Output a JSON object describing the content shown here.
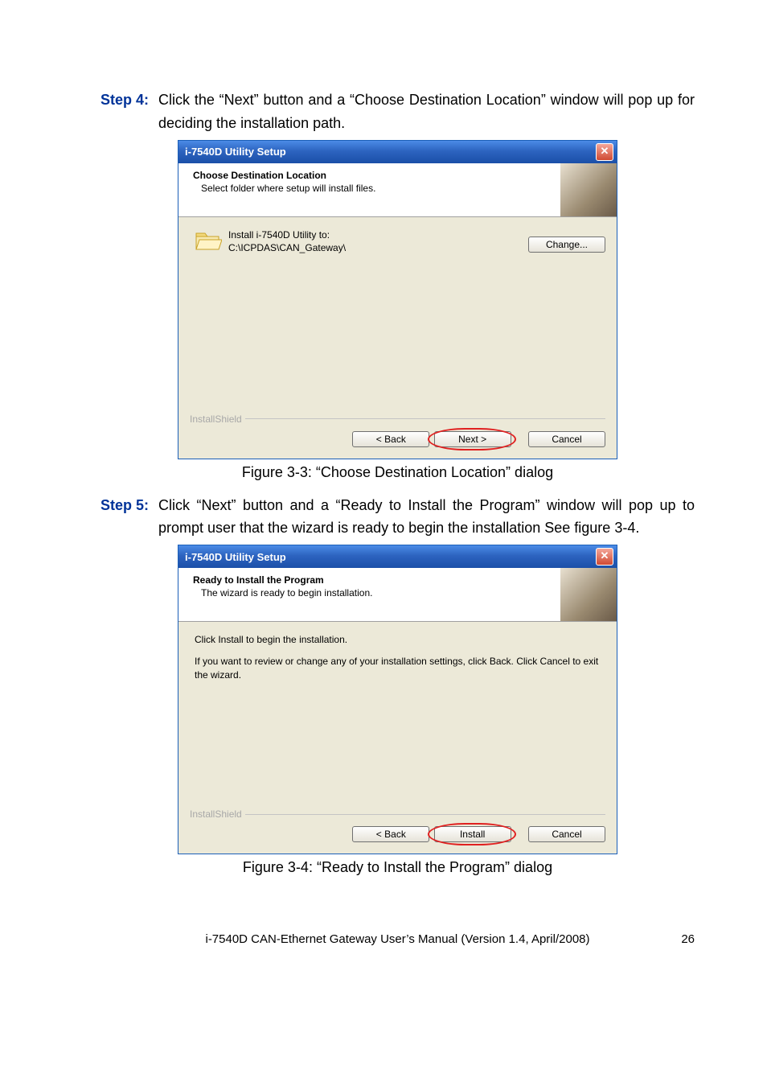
{
  "step4": {
    "label": "Step 4:",
    "text": "Click the “Next” button and a “Choose Destination Location” window will pop up for deciding the installation path."
  },
  "dialog1": {
    "title": "i-7540D Utility Setup",
    "header_title": "Choose Destination Location",
    "header_sub": "Select folder where setup will install files.",
    "install_label": "Install i-7540D Utility to:",
    "install_path": "C:\\ICPDAS\\CAN_Gateway\\",
    "change_btn": "Change...",
    "brand": "InstallShield",
    "back_btn": "< Back",
    "next_btn": "Next >",
    "cancel_btn": "Cancel"
  },
  "caption1": "Figure 3-3: “Choose Destination Location” dialog",
  "step5": {
    "label": "Step 5:",
    "text": "Click “Next” button and a “Ready to Install the Program” window will pop up to prompt user that the wizard is ready to begin the installation See figure 3-4."
  },
  "dialog2": {
    "title": "i-7540D Utility Setup",
    "header_title": "Ready to Install the Program",
    "header_sub": "The wizard is ready to begin installation.",
    "line1": "Click Install to begin the installation.",
    "line2": "If you want to review or change any of your installation settings, click Back. Click Cancel to exit the wizard.",
    "brand": "InstallShield",
    "back_btn": "< Back",
    "install_btn": "Install",
    "cancel_btn": "Cancel"
  },
  "caption2": "Figure 3-4: “Ready to Install the Program” dialog",
  "footer": {
    "text": "i-7540D CAN-Ethernet Gateway User’s Manual (Version 1.4, April/2008)",
    "page": "26"
  }
}
